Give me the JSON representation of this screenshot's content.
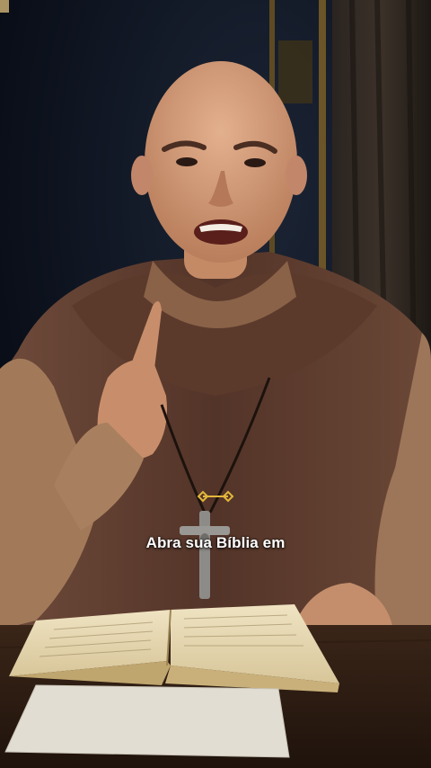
{
  "video": {
    "caption": "Abra sua Bíblia em"
  },
  "icons": {
    "subtitle_marker": "gold-diamond-bar-icon",
    "crucifix": "crucifix-icon"
  },
  "colors": {
    "background": "#0c1422",
    "habit": "#5a3a2e",
    "caption": "#ffffff",
    "marker": "#e2b83c"
  }
}
